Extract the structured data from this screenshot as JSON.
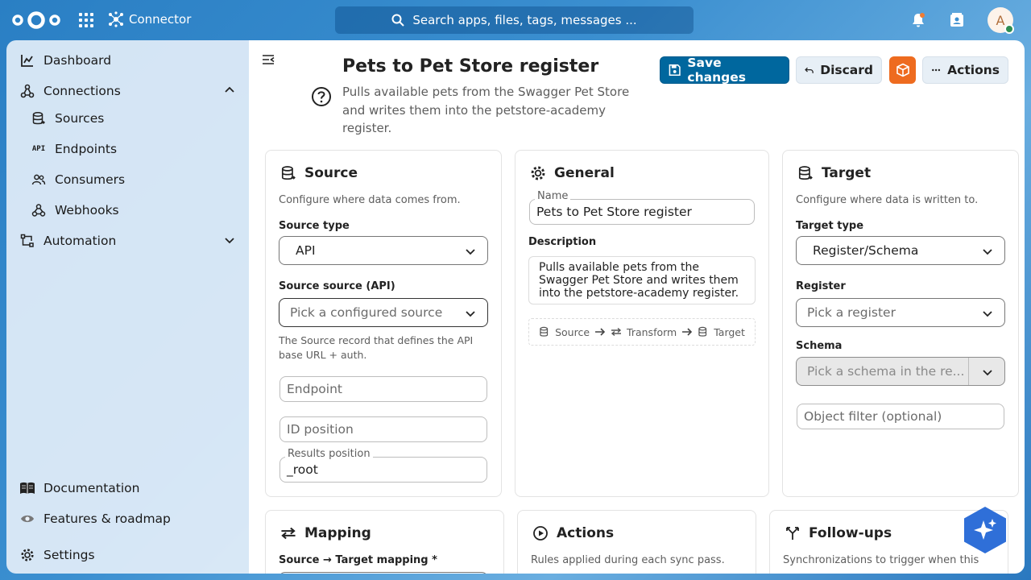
{
  "topbar": {
    "app_name": "Connector",
    "search_placeholder": "Search apps, files, tags, messages ...",
    "avatar_initial": "A"
  },
  "sidebar": {
    "items": [
      {
        "label": "Dashboard",
        "icon": "chart-icon"
      },
      {
        "label": "Connections",
        "icon": "connections-icon",
        "expanded": true
      },
      {
        "label": "Sources",
        "icon": "database-icon"
      },
      {
        "label": "Endpoints",
        "icon": "api-icon"
      },
      {
        "label": "Consumers",
        "icon": "users-icon"
      },
      {
        "label": "Webhooks",
        "icon": "webhook-icon"
      },
      {
        "label": "Automation",
        "icon": "automation-icon",
        "expanded": false
      }
    ],
    "footer": [
      {
        "label": "Documentation",
        "icon": "book-icon"
      },
      {
        "label": "Features & roadmap",
        "icon": "eye-icon"
      },
      {
        "label": "Settings",
        "icon": "gear-icon"
      }
    ]
  },
  "page": {
    "title": "Pets to Pet Store register",
    "description": "Pulls available pets from the Swagger Pet Store and writes them into the petstore-academy register."
  },
  "toolbar": {
    "save_label": "Save changes",
    "discard_label": "Discard",
    "actions_label": "Actions"
  },
  "source_card": {
    "title": "Source",
    "subtitle": "Configure where data comes from.",
    "source_type_label": "Source type",
    "source_type_value": "API",
    "source_source_label": "Source source (API)",
    "source_source_placeholder": "Pick a configured source",
    "help_text": "The Source record that defines the API base URL + auth.",
    "endpoint_placeholder": "Endpoint",
    "id_position_placeholder": "ID position",
    "results_position_label": "Results position",
    "results_position_value": "_root"
  },
  "general_card": {
    "title": "General",
    "name_label": "Name",
    "name_value": "Pets to Pet Store register",
    "description_label": "Description",
    "description_value": "Pulls available pets from the Swagger Pet Store and writes them into the petstore-academy register.",
    "flow": [
      "Source",
      "Transform",
      "Target"
    ]
  },
  "target_card": {
    "title": "Target",
    "subtitle": "Configure where data is written to.",
    "target_type_label": "Target type",
    "target_type_value": "Register/Schema",
    "register_label": "Register",
    "register_placeholder": "Pick a register",
    "schema_label": "Schema",
    "schema_placeholder": "Pick a schema in the re...",
    "object_filter_placeholder": "Object filter (optional)"
  },
  "mapping_card": {
    "title": "Mapping",
    "mapping_label": "Source → Target mapping *"
  },
  "actions_card": {
    "title": "Actions",
    "subtitle": "Rules applied during each sync pass."
  },
  "followups_card": {
    "title": "Follow-ups",
    "subtitle": "Synchronizations to trigger when this"
  },
  "colors": {
    "primary": "#00679e",
    "accent_orange": "#ee6b1f",
    "assistant": "#2f6fd8"
  }
}
